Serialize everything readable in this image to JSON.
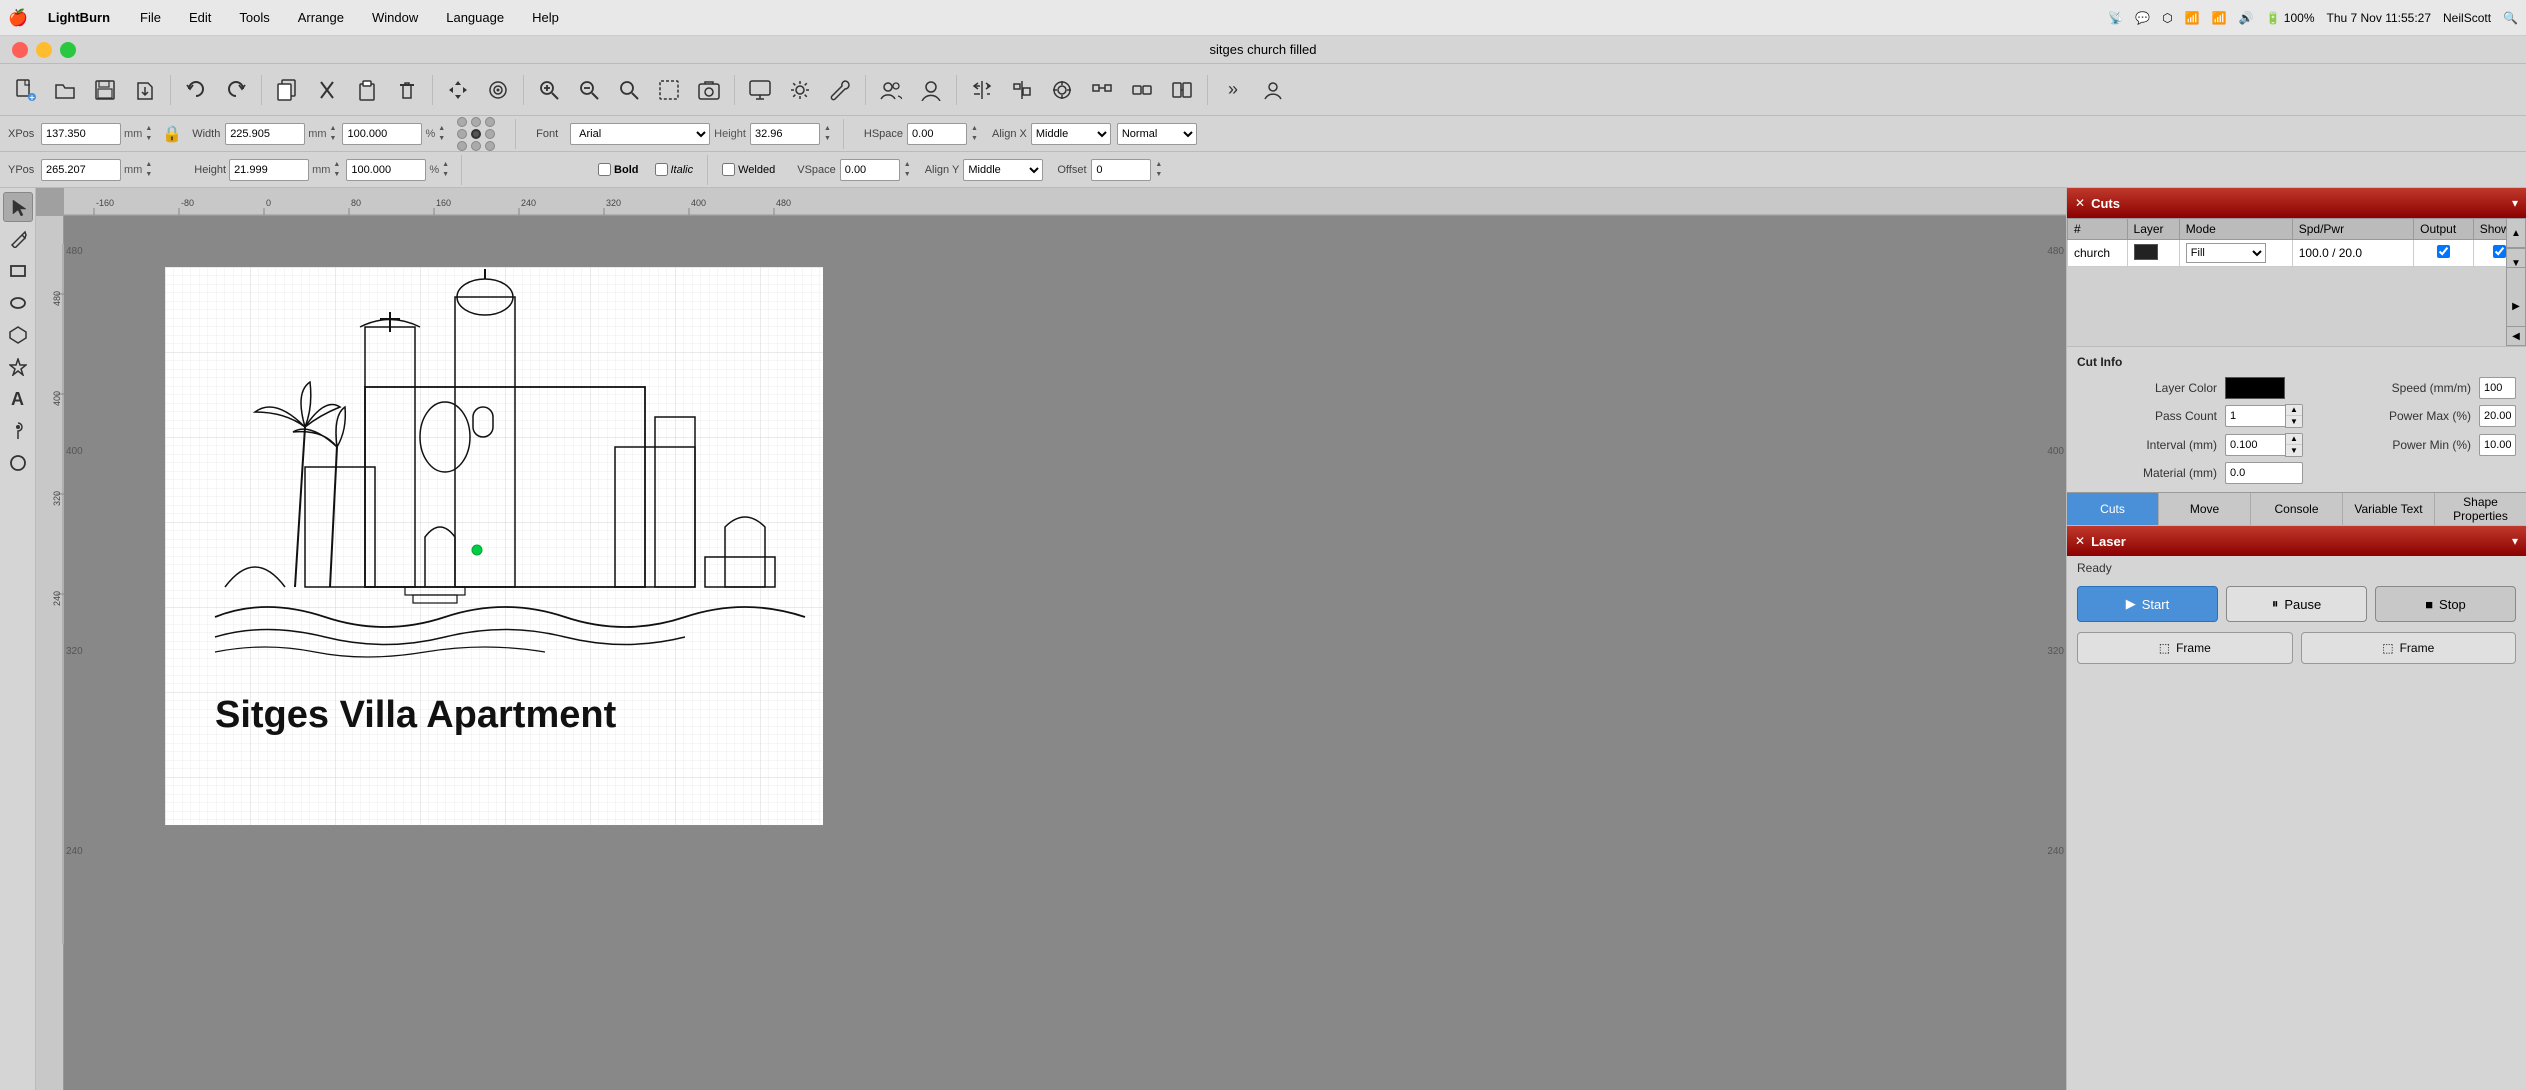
{
  "app": {
    "name": "LightBurn",
    "title": "sitges church filled"
  },
  "menubar": {
    "apple": "🍎",
    "items": [
      "File",
      "Edit",
      "Tools",
      "Arrange",
      "Window",
      "Language",
      "Help"
    ]
  },
  "toolbar": {
    "buttons": [
      {
        "name": "new",
        "icon": "⬜",
        "label": "New"
      },
      {
        "name": "open",
        "icon": "📂",
        "label": "Open"
      },
      {
        "name": "save",
        "icon": "💾",
        "label": "Save"
      },
      {
        "name": "export",
        "icon": "📤",
        "label": "Export"
      },
      {
        "name": "undo",
        "icon": "↩",
        "label": "Undo"
      },
      {
        "name": "redo",
        "icon": "↪",
        "label": "Redo"
      },
      {
        "name": "copy",
        "icon": "⧉",
        "label": "Copy"
      },
      {
        "name": "cut",
        "icon": "✂",
        "label": "Cut"
      },
      {
        "name": "paste",
        "icon": "📋",
        "label": "Paste"
      },
      {
        "name": "delete",
        "icon": "🗑",
        "label": "Delete"
      },
      {
        "name": "move",
        "icon": "✛",
        "label": "Move"
      },
      {
        "name": "clone",
        "icon": "⊕",
        "label": "Clone"
      },
      {
        "name": "zoom-in",
        "icon": "🔍",
        "label": "Zoom In"
      },
      {
        "name": "zoom-out",
        "icon": "🔎",
        "label": "Zoom Out"
      },
      {
        "name": "zoom-fit",
        "icon": "⊡",
        "label": "Zoom Fit"
      },
      {
        "name": "select-all",
        "icon": "⬛",
        "label": "Select All"
      },
      {
        "name": "camera",
        "icon": "📷",
        "label": "Camera"
      },
      {
        "name": "monitor",
        "icon": "🖥",
        "label": "Monitor"
      },
      {
        "name": "settings",
        "icon": "⚙",
        "label": "Settings"
      },
      {
        "name": "tools",
        "icon": "🔧",
        "label": "Tools"
      },
      {
        "name": "users",
        "icon": "👥",
        "label": "Users"
      },
      {
        "name": "user",
        "icon": "👤",
        "label": "User"
      }
    ]
  },
  "coords": {
    "xpos_label": "XPos",
    "xpos_value": "137.350",
    "ypos_label": "YPos",
    "ypos_value": "265.207",
    "width_label": "Width",
    "width_value": "225.905",
    "height_label": "Height",
    "height_value": "21.999",
    "mm": "mm",
    "percent1": "100.000",
    "percent2": "100.000",
    "percent_sign": "%"
  },
  "font": {
    "label": "Font",
    "value": "Arial",
    "height_label": "Height",
    "height_value": "32.96",
    "hspace_label": "HSpace",
    "hspace_value": "0.00",
    "alignx_label": "Align X",
    "alignx_value": "Middle",
    "normal_value": "Normal",
    "bold_label": "Bold",
    "italic_label": "Italic",
    "welded_label": "Welded",
    "vspace_label": "VSpace",
    "vspace_value": "0.00",
    "aligny_label": "Align Y",
    "aligny_value": "Middle",
    "offset_label": "Offset",
    "offset_value": "0"
  },
  "cuts_panel": {
    "title": "Cuts",
    "columns": {
      "hash": "#",
      "layer": "Layer",
      "mode": "Mode",
      "spd_pwr": "Spd/Pwr",
      "output": "Output",
      "show": "Show"
    },
    "rows": [
      {
        "hash": "church",
        "color": "#222222",
        "mode": "Fill",
        "spd_pwr": "100.0 / 20.0",
        "output": true,
        "show": true
      }
    ]
  },
  "cut_info": {
    "title": "Cut Info",
    "layer_color_label": "Layer Color",
    "speed_label": "Speed (mm/m)",
    "speed_value": "100",
    "pass_count_label": "Pass Count",
    "pass_count_value": "1",
    "power_max_label": "Power Max (%)",
    "power_max_value": "20.00",
    "interval_label": "Interval (mm)",
    "interval_value": "0.100",
    "power_min_label": "Power Min (%)",
    "power_min_value": "10.00",
    "material_label": "Material (mm)",
    "material_value": "0.0"
  },
  "tabs": {
    "cuts": "Cuts",
    "move": "Move",
    "console": "Console",
    "variable_text": "Variable Text",
    "shape_properties": "Shape Properties"
  },
  "laser_panel": {
    "title": "Laser",
    "status": "Ready",
    "start": "Start",
    "pause": "Pause",
    "stop": "Stop",
    "frame": "Frame"
  },
  "left_tools": [
    {
      "name": "select",
      "icon": "↖",
      "label": "Select"
    },
    {
      "name": "draw",
      "icon": "✏",
      "label": "Draw"
    },
    {
      "name": "rect",
      "icon": "▭",
      "label": "Rectangle"
    },
    {
      "name": "ellipse",
      "icon": "○",
      "label": "Ellipse"
    },
    {
      "name": "polygon",
      "icon": "⬡",
      "label": "Polygon"
    },
    {
      "name": "star",
      "icon": "⬟",
      "label": "Star"
    },
    {
      "name": "text",
      "icon": "A",
      "label": "Text"
    },
    {
      "name": "pin",
      "icon": "📍",
      "label": "Pin"
    }
  ],
  "canvas": {
    "drawing_title": "Sitges Villa Apartment",
    "ruler_labels": [
      "-160",
      "-80",
      "0",
      "80",
      "160",
      "240",
      "320",
      "400",
      "480"
    ],
    "y_ruler_labels": [
      "480",
      "400",
      "320",
      "240"
    ]
  },
  "status_bar": {
    "normal_label": "Normal"
  }
}
